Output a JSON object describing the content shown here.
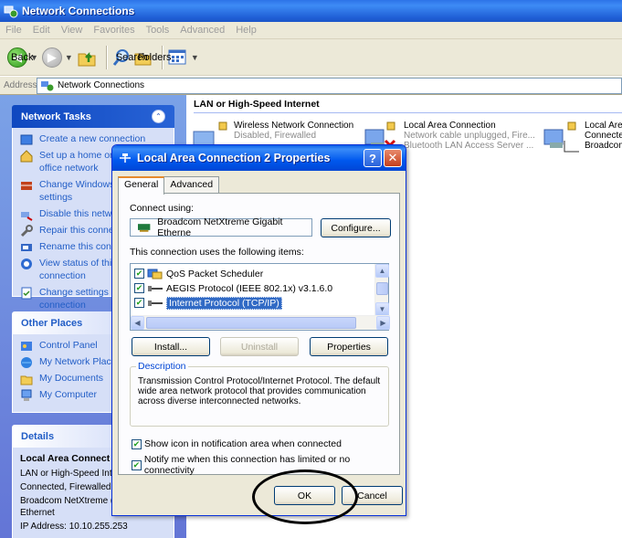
{
  "window": {
    "title": "Network Connections",
    "menu": [
      "File",
      "Edit",
      "View",
      "Favorites",
      "Tools",
      "Advanced",
      "Help"
    ],
    "toolbar": {
      "back": "Back",
      "search": "Search",
      "folders": "Folders"
    },
    "address": {
      "label": "Address",
      "value": "Network Connections"
    }
  },
  "taskpane": {
    "network_tasks": {
      "title": "Network Tasks",
      "items": [
        "Create a new connection",
        "Set up a home or small office network",
        "Change Windows Firewall settings",
        "Disable this network device",
        "Repair this connection",
        "Rename this connection",
        "View status of this connection",
        "Change settings of this connection"
      ],
      "items_visible": [
        "Create a new connection",
        "Set up a home or",
        "office network",
        "Change Windows",
        "settings",
        "Disable this netwo",
        "Repair this conne",
        "Rename this conn",
        "View status of thi",
        "connection",
        "Change settings o",
        "connection"
      ]
    },
    "other_places": {
      "title": "Other Places",
      "items": [
        "Control Panel",
        "My Network Place",
        "My Documents",
        "My Computer"
      ]
    },
    "details": {
      "title": "Details",
      "name": "Local Area Connect",
      "lines": [
        "LAN or High-Speed Int",
        "Connected, Firewalled",
        "Broadcom NetXtreme (",
        "Ethernet",
        "IP Address: 10.10.255.253"
      ]
    }
  },
  "content": {
    "group_header": "LAN or High-Speed Internet",
    "connections": [
      {
        "name": "Wireless Network Connection",
        "status": "Disabled, Firewalled",
        "device": ""
      },
      {
        "name": "Local Area Connection",
        "status": "Network cable unplugged, Fire...",
        "device": "Bluetooth LAN Access Server ..."
      },
      {
        "name": "Local Area",
        "status": "Connected",
        "device": "Broadcom"
      }
    ]
  },
  "dialog": {
    "title": "Local Area Connection 2 Properties",
    "tabs": [
      "General",
      "Advanced"
    ],
    "connect_using_label": "Connect using:",
    "adapter": "Broadcom NetXtreme Gigabit Etherne",
    "configure_btn": "Configure...",
    "items_label": "This connection uses the following items:",
    "items": [
      {
        "label": "QoS Packet Scheduler",
        "checked": true
      },
      {
        "label": "AEGIS Protocol (IEEE 802.1x) v3.1.6.0",
        "checked": true
      },
      {
        "label": "Internet Protocol (TCP/IP)",
        "checked": true,
        "selected": true
      }
    ],
    "install_btn": "Install...",
    "uninstall_btn": "Uninstall",
    "properties_btn": "Properties",
    "description_legend": "Description",
    "description": "Transmission Control Protocol/Internet Protocol. The default wide area network protocol that provides communication across diverse interconnected networks.",
    "show_icon_label": "Show icon in notification area when connected",
    "notify_label": "Notify me when this connection has limited or no connectivity",
    "ok_btn": "OK",
    "cancel_btn": "Cancel"
  },
  "colors": {
    "xp_blue": "#0058ee",
    "task_link": "#215dc6",
    "selection": "#316ac5",
    "annotation": "#000000"
  }
}
